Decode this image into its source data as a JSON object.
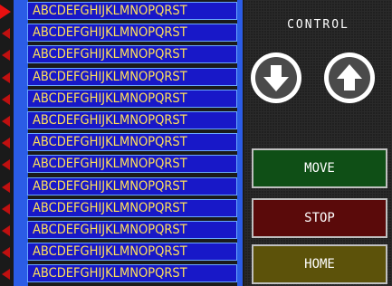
{
  "list": {
    "items": [
      {
        "label": "ABCDEFGHIJKLMNOPQRST",
        "marker": "active"
      },
      {
        "label": "ABCDEFGHIJKLMNOPQRST",
        "marker": "idle"
      },
      {
        "label": "ABCDEFGHIJKLMNOPQRST",
        "marker": "idle"
      },
      {
        "label": "ABCDEFGHIJKLMNOPQRST",
        "marker": "idle"
      },
      {
        "label": "ABCDEFGHIJKLMNOPQRST",
        "marker": "idle"
      },
      {
        "label": "ABCDEFGHIJKLMNOPQRST",
        "marker": "idle"
      },
      {
        "label": "ABCDEFGHIJKLMNOPQRST",
        "marker": "idle"
      },
      {
        "label": "ABCDEFGHIJKLMNOPQRST",
        "marker": "idle"
      },
      {
        "label": "ABCDEFGHIJKLMNOPQRST",
        "marker": "idle"
      },
      {
        "label": "ABCDEFGHIJKLMNOPQRST",
        "marker": "idle"
      },
      {
        "label": "ABCDEFGHIJKLMNOPQRST",
        "marker": "idle"
      },
      {
        "label": "ABCDEFGHIJKLMNOPQRST",
        "marker": "idle"
      },
      {
        "label": "ABCDEFGHIJKLMNOPQRST",
        "marker": "idle"
      }
    ],
    "colors": {
      "cell_bg": "#1818c8",
      "cell_text": "#ffe05a",
      "cell_border": "#6aa8ff",
      "marker": "#e81010"
    }
  },
  "control": {
    "title": "CONTROL",
    "down_icon": "arrow-down-icon",
    "up_icon": "arrow-up-icon",
    "move_label": "MOVE",
    "stop_label": "STOP",
    "home_label": "HOME",
    "colors": {
      "move": "#0f4f16",
      "stop": "#5a0a0a",
      "home": "#5c520a"
    }
  }
}
